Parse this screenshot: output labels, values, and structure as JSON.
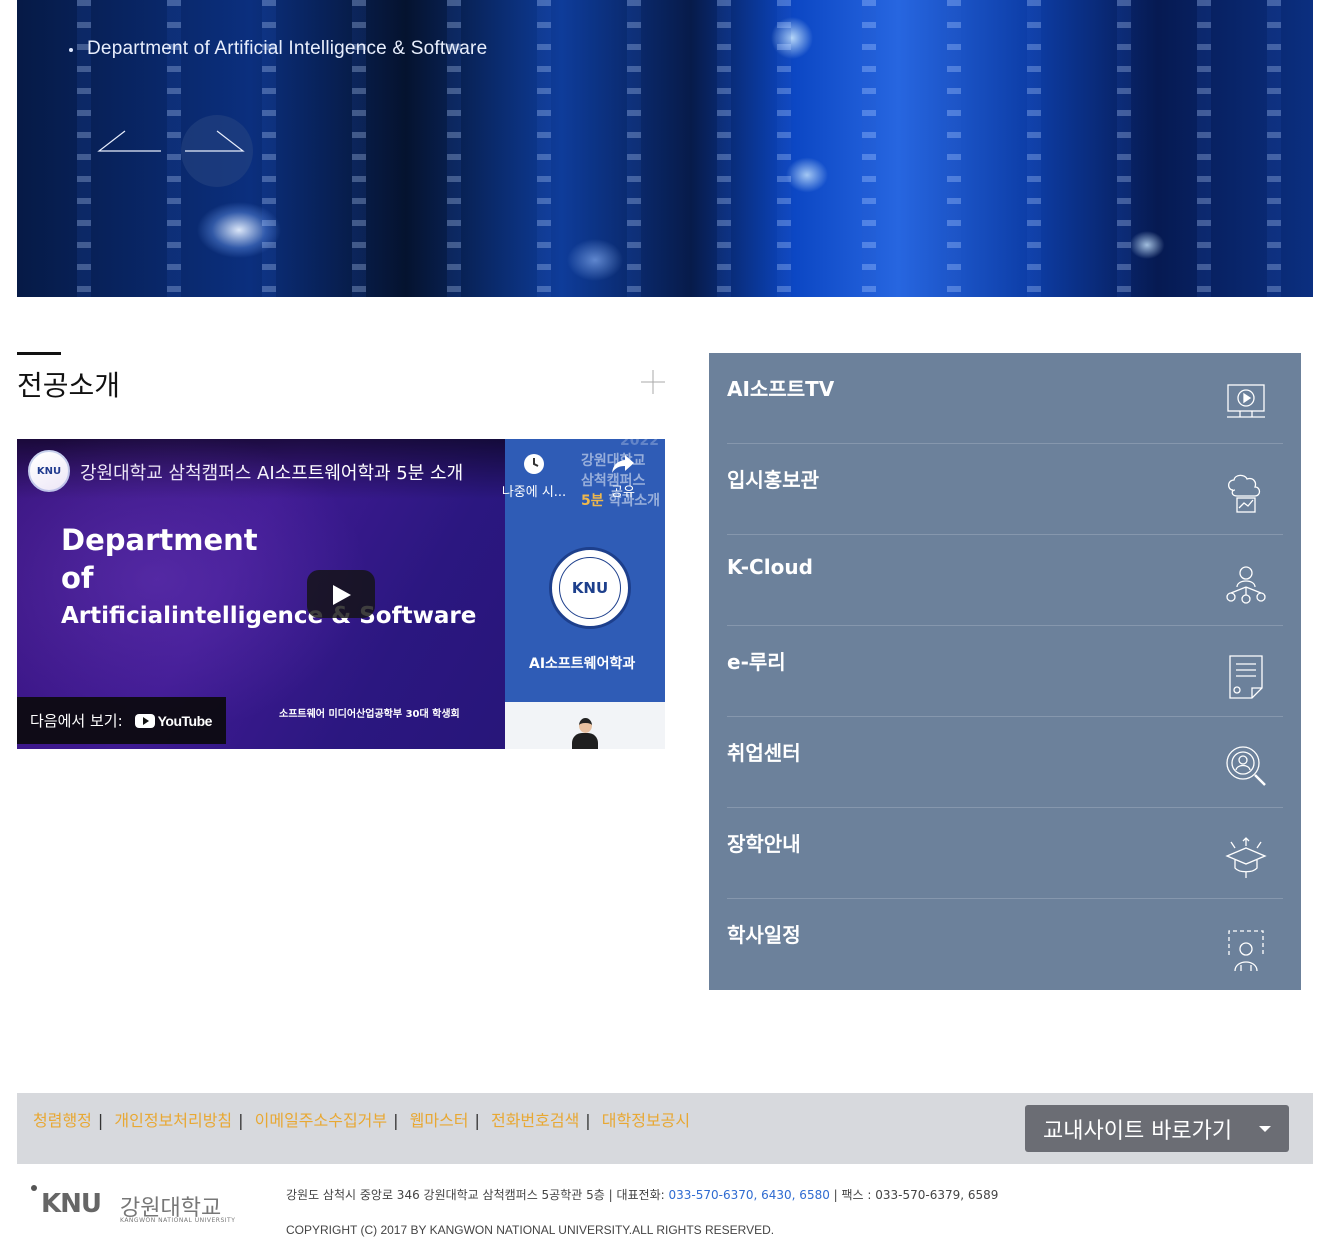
{
  "hero": {
    "subtitle": "Department of Artificial Intelligence & Software",
    "prev_icon": "arrow-left-icon",
    "next_icon": "arrow-right-icon"
  },
  "intro": {
    "title": "전공소개",
    "more_icon": "plus-icon"
  },
  "video": {
    "title": "강원대학교 삼척캠퍼스 AI소프트웨어학과 5분 소개",
    "channel_logo": "KNU",
    "headline": [
      "Department",
      "of",
      "Artificialintelligence & Software"
    ],
    "council": "소프트웨어 미디어산업공학부 30대 학생회",
    "watch_later": "나중에 시...",
    "share": "공유",
    "watch_on_label": "다음에서 보기:",
    "youtube_label": "YouTube",
    "side_year": "2022",
    "side_caption": [
      "강원대학교",
      "삼척캠퍼스"
    ],
    "side_caption_highlight": "5분",
    "side_caption_rest": " 학과소개",
    "seal_text": "KNU",
    "side_dept": "AI소프트웨어학과"
  },
  "quick_menu": [
    {
      "label": "AI소프트TV",
      "icon": "video-play-icon"
    },
    {
      "label": "입시홍보관",
      "icon": "cloud-chart-icon"
    },
    {
      "label": "K-Cloud",
      "icon": "network-person-icon"
    },
    {
      "label": "e-루리",
      "icon": "document-icon"
    },
    {
      "label": "취업센터",
      "icon": "search-person-icon"
    },
    {
      "label": "장학안내",
      "icon": "graduation-cap-icon"
    },
    {
      "label": "학사일정",
      "icon": "calendar-person-icon"
    }
  ],
  "colors": {
    "quick_menu_bg": "#6c819b",
    "footer_link": "#e8a833",
    "footer_bar": "#d7d9dd",
    "site_select_bg": "#6b6d74"
  },
  "footer": {
    "links": [
      "청렴행정",
      "개인정보처리방침",
      "이메일주소수집거부",
      "웹마스터",
      "전화번호검색",
      "대학정보공시"
    ],
    "site_select": "교내사이트 바로가기",
    "logo_knu": "KNU",
    "logo_kor": "강원대학교",
    "logo_eng": "KANGWON NATIONAL UNIVERSITY",
    "address_prefix": "강원도 삼척시 중앙로 346 강원대학교 삼척캠퍼스 5공학관 5층 | 대표전화: ",
    "phone": "033-570-6370, 6430, 6580",
    "address_suffix": " | 팩스 : 033-570-6379, 6589",
    "copyright": "COPYRIGHT (C) 2017 BY KANGWON NATIONAL UNIVERSITY.ALL RIGHTS RESERVED."
  }
}
